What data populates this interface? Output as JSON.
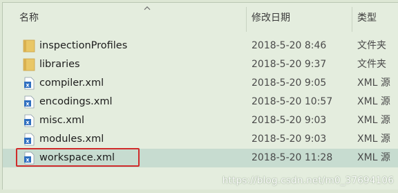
{
  "columns": {
    "name": "名称",
    "modified": "修改日期",
    "type": "类型"
  },
  "files": [
    {
      "name": "inspectionProfiles",
      "modified": "2018-5-20 8:46",
      "type": "文件夹",
      "icon": "folder-icon"
    },
    {
      "name": "libraries",
      "modified": "2018-5-20 9:37",
      "type": "文件夹",
      "icon": "folder-icon"
    },
    {
      "name": "compiler.xml",
      "modified": "2018-5-20 9:05",
      "type": "XML 源",
      "icon": "xml-file-icon"
    },
    {
      "name": "encodings.xml",
      "modified": "2018-5-20 10:57",
      "type": "XML 源",
      "icon": "xml-file-icon"
    },
    {
      "name": "misc.xml",
      "modified": "2018-5-20 9:03",
      "type": "XML 源",
      "icon": "xml-file-icon"
    },
    {
      "name": "modules.xml",
      "modified": "2018-5-20 9:03",
      "type": "XML 源",
      "icon": "xml-file-icon"
    },
    {
      "name": "workspace.xml",
      "modified": "2018-5-20 11:28",
      "type": "XML 源",
      "icon": "xml-file-icon",
      "selected": true
    }
  ],
  "watermark": "https://blog.csdn.net/m0_37694106",
  "colors": {
    "background": "#e4edde",
    "selected_row": "#c7dcd0",
    "highlight_border": "#d02a2a",
    "folder": "#e9c766",
    "xml_icon": "#2f6fc0"
  }
}
